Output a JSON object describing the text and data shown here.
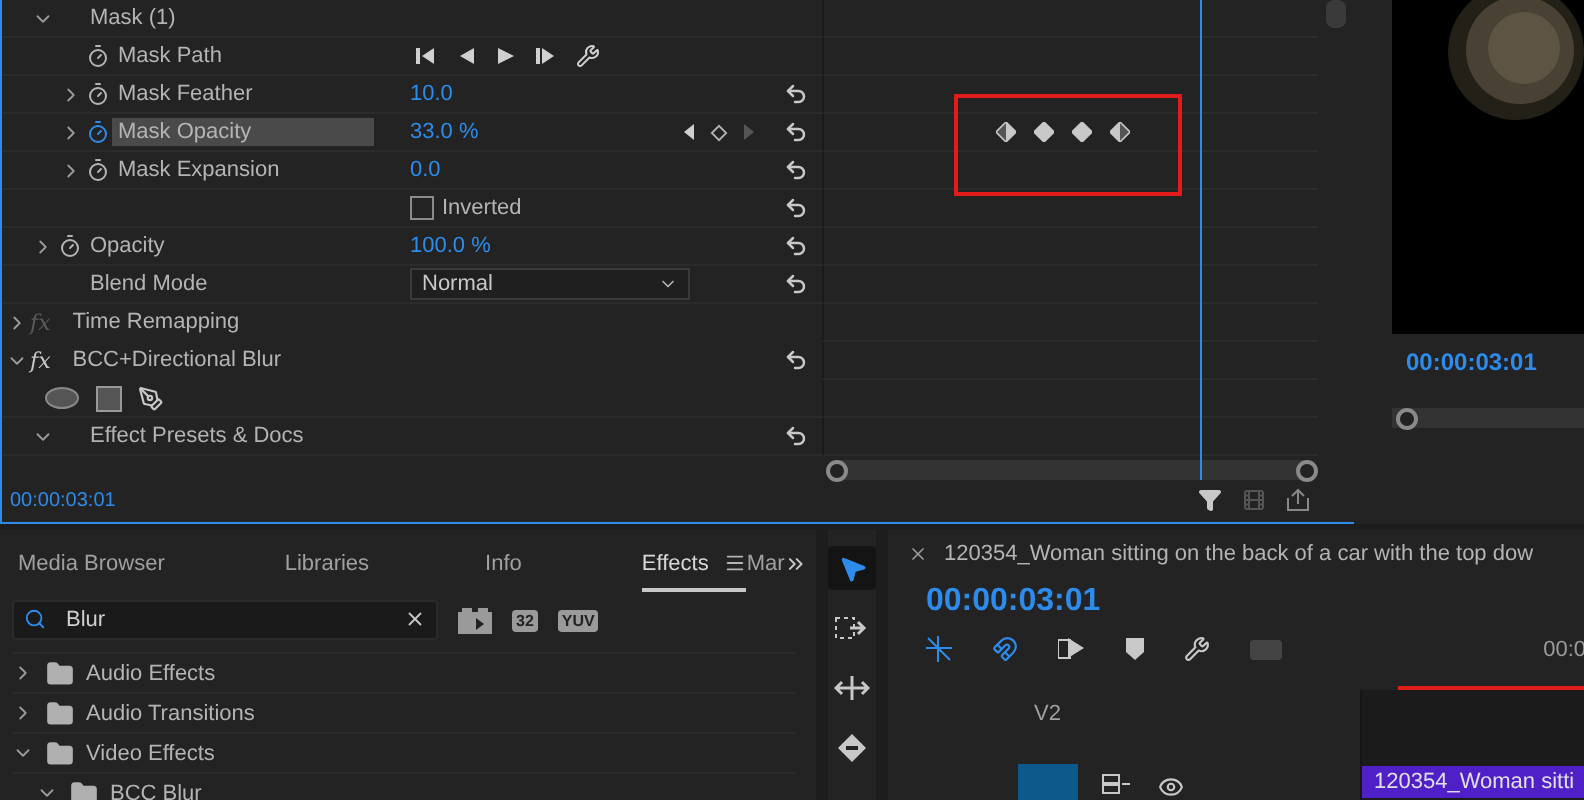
{
  "effect_controls": {
    "items": [
      {
        "kind": "group",
        "label": "Mask (1)",
        "expanded": true,
        "reset": false,
        "children": [
          {
            "kind": "path",
            "label": "Mask Path",
            "reset": false
          },
          {
            "kind": "param",
            "label": "Mask Feather",
            "value": "10.0",
            "expanded": false,
            "animated": false,
            "selected": false,
            "reset": true
          },
          {
            "kind": "param",
            "label": "Mask Opacity",
            "value": "33.0 %",
            "expanded": false,
            "animated": true,
            "selected": true,
            "reset": true,
            "keyframes": [
              {
                "kind": "in"
              },
              {
                "kind": "key"
              },
              {
                "kind": "key"
              },
              {
                "kind": "out"
              }
            ]
          },
          {
            "kind": "param",
            "label": "Mask Expansion",
            "value": "0.0",
            "expanded": false,
            "animated": false,
            "selected": false,
            "reset": true
          },
          {
            "kind": "checkbox",
            "label": "Inverted",
            "checked": false,
            "reset": true
          }
        ]
      },
      {
        "kind": "param",
        "label": "Opacity",
        "value": "100.0 %",
        "expanded": false,
        "animated": false,
        "selected": false,
        "reset": true
      },
      {
        "kind": "dropdown",
        "label": "Blend Mode",
        "value": "Normal",
        "reset": true
      }
    ],
    "effects": [
      {
        "kind": "effect",
        "fx": "fx",
        "label": "Time Remapping",
        "enabled": false,
        "expanded": false,
        "reset": false
      },
      {
        "kind": "effect",
        "fx": "fx",
        "label": "BCC+Directional Blur",
        "enabled": true,
        "expanded": true,
        "reset": true,
        "children": [
          {
            "kind": "shapes",
            "reset": false
          },
          {
            "kind": "group",
            "label": "Effect Presets & Docs",
            "expanded": true,
            "reset": true
          }
        ]
      }
    ],
    "keyframe_highlight": true,
    "timecode": "00:00:03:01"
  },
  "program_monitor": {
    "timecode": "00:00:03:01"
  },
  "effects_panel": {
    "tabs": [
      {
        "label": "Media Browser",
        "selected": false
      },
      {
        "label": "Libraries",
        "selected": false
      },
      {
        "label": "Info",
        "selected": false
      },
      {
        "label": "Effects",
        "selected": true
      },
      {
        "label": "Mar",
        "selected": false
      }
    ],
    "search": {
      "value": "Blur"
    },
    "badges": [
      "32",
      "YUV"
    ],
    "tree": [
      {
        "label": "Audio Effects",
        "expanded": false
      },
      {
        "label": "Audio Transitions",
        "expanded": false
      },
      {
        "label": "Video Effects",
        "expanded": true,
        "children": [
          {
            "label": "BCC Blur",
            "expanded": true
          }
        ]
      }
    ]
  },
  "tools": [
    {
      "kind": "select",
      "selected": true
    },
    {
      "kind": "track",
      "selected": false
    },
    {
      "kind": "ripple",
      "selected": false
    },
    {
      "kind": "razor",
      "selected": false
    }
  ],
  "timeline": {
    "title": "120354_Woman sitting on the back of a car with the top dow",
    "timecode": "00:00:03:01",
    "ruler_label": "00:0",
    "tracks": [
      {
        "label": "V2",
        "targeted": false
      },
      {
        "targeted": true,
        "clip": "120354_Woman sitti"
      }
    ]
  }
}
